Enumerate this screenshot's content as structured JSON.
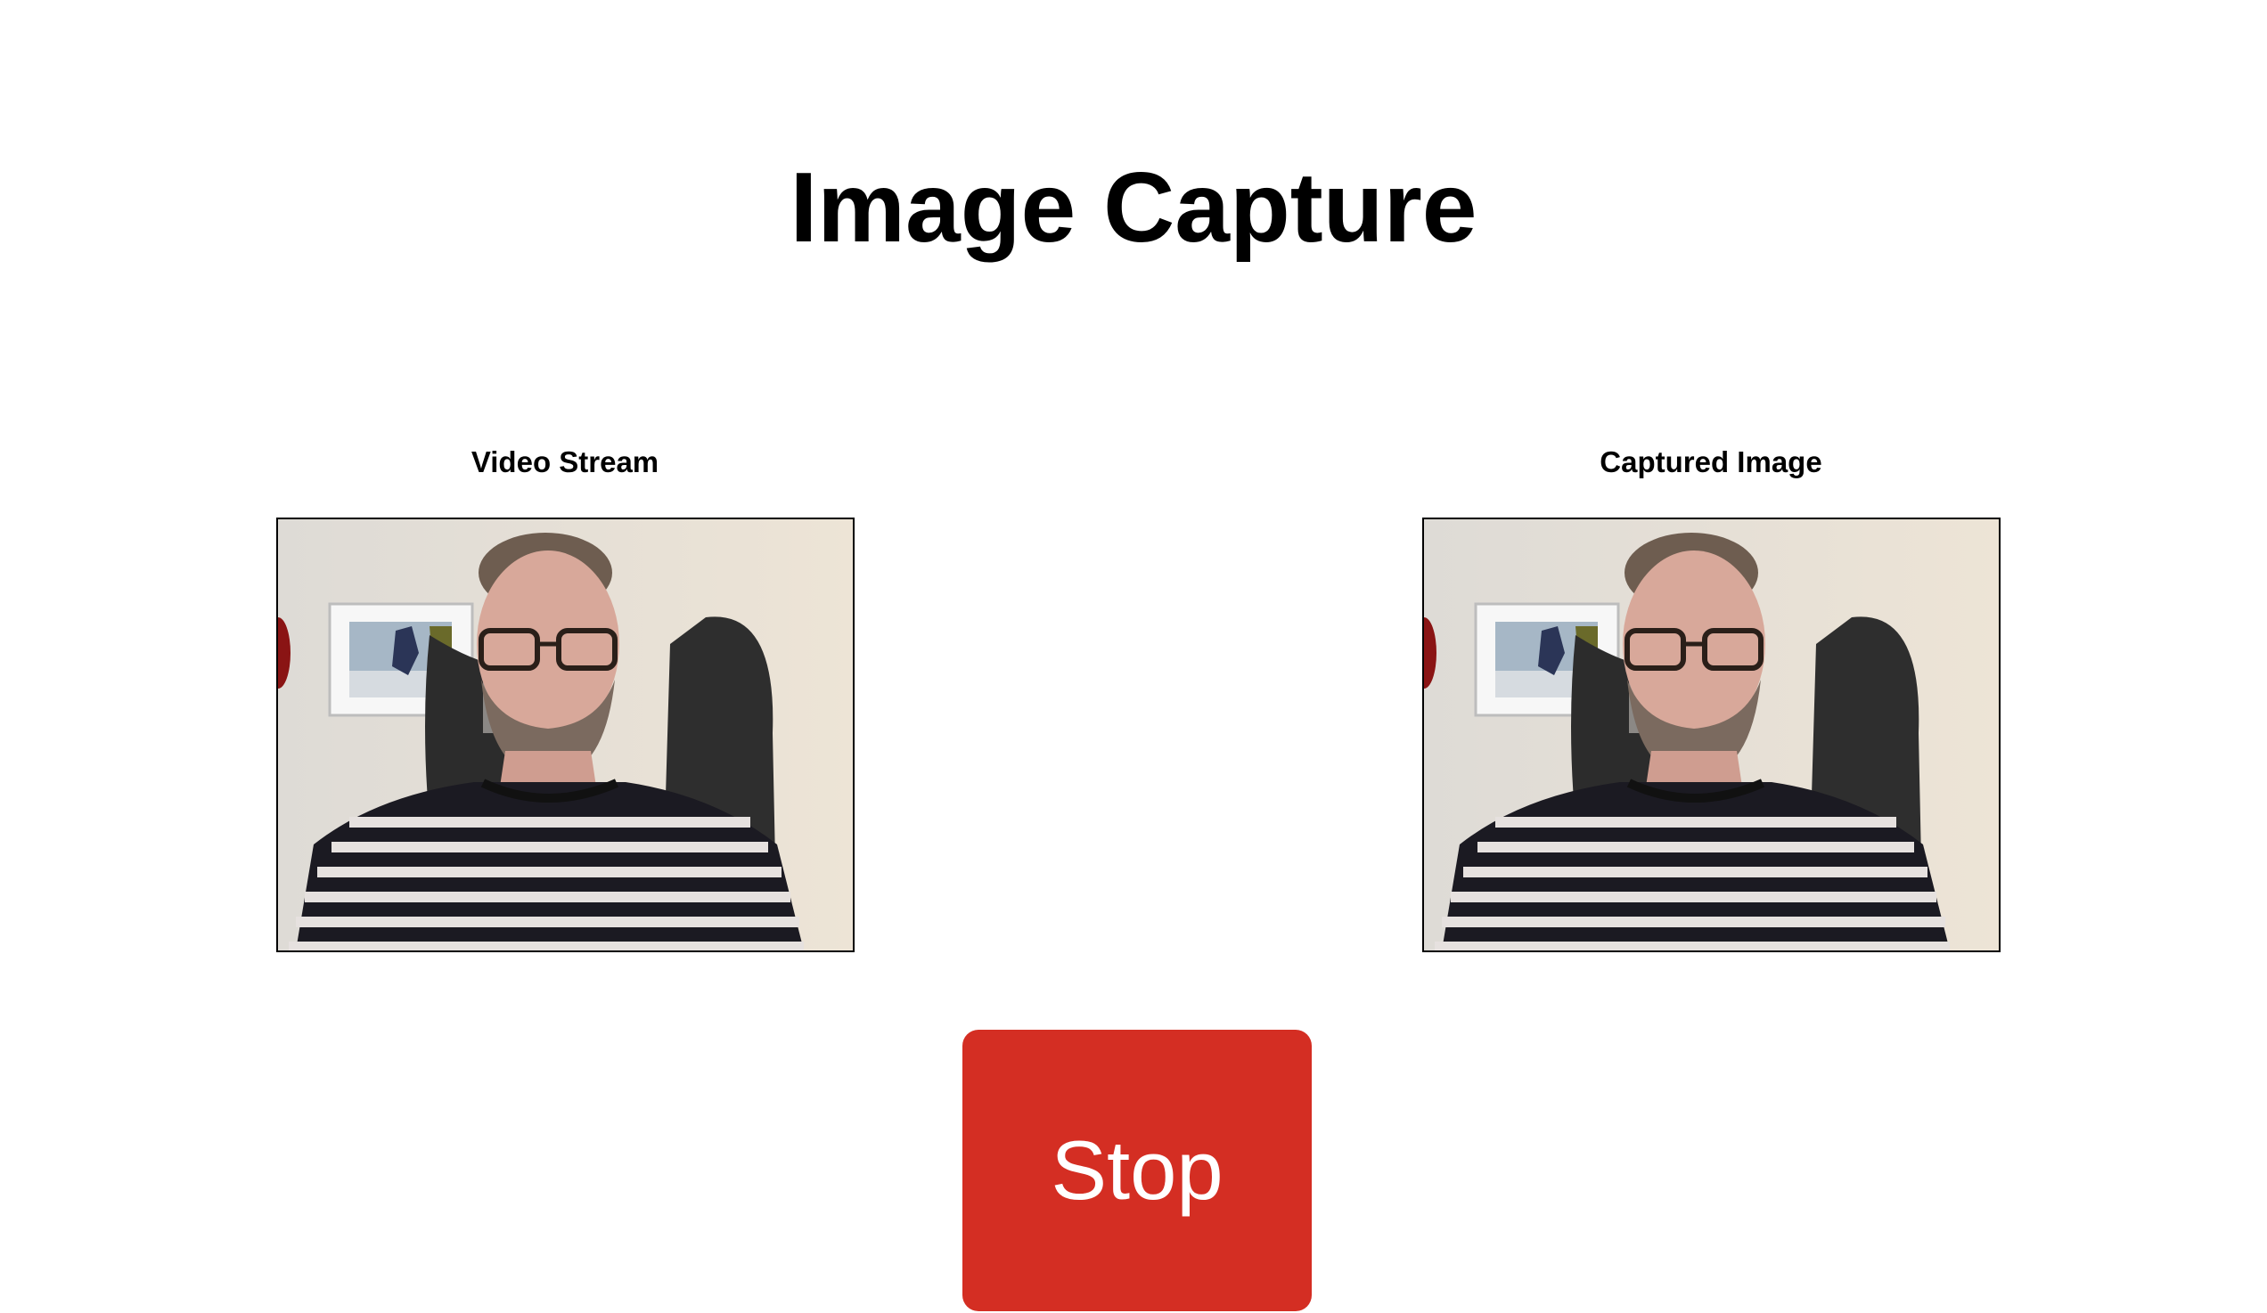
{
  "title": "Image Capture",
  "video_panel": {
    "label": "Video Stream"
  },
  "capture_panel": {
    "label": "Captured Image"
  },
  "stop_button": {
    "label": "Stop"
  },
  "colors": {
    "stop_button_bg": "#d42e23",
    "frame_border": "#000000"
  }
}
